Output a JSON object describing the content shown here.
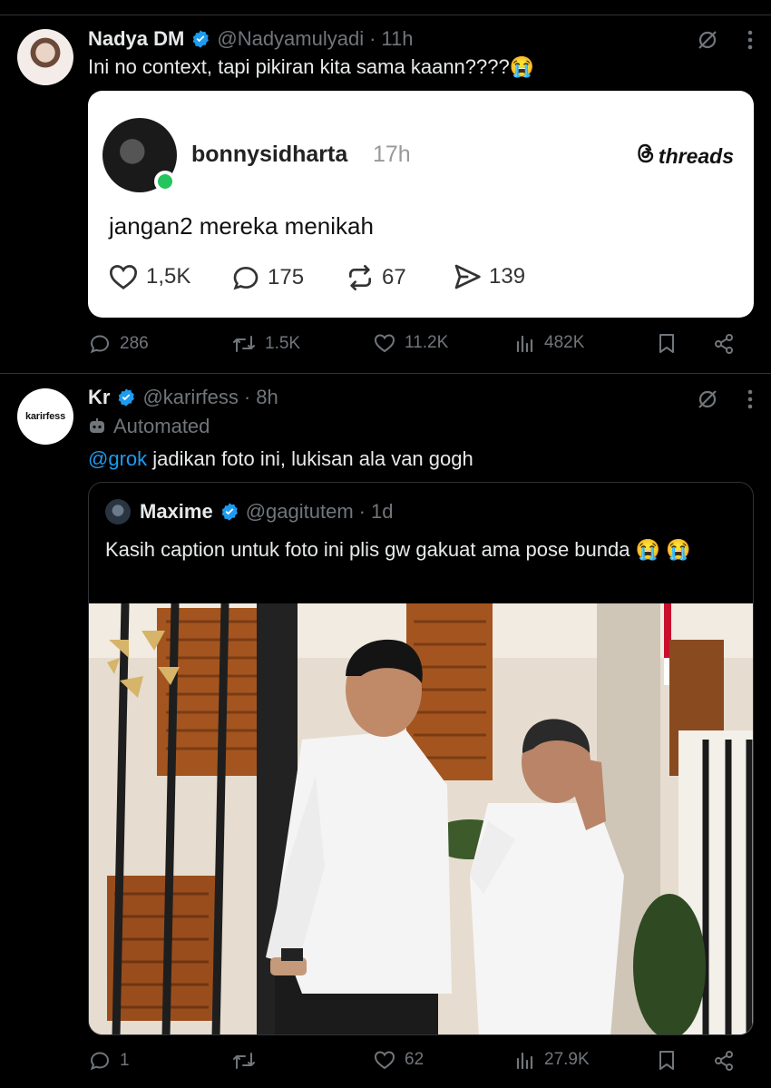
{
  "tweet1": {
    "name": "Nadya DM",
    "handle": "@Nadyamulyadi",
    "time": "11h",
    "text": "Ini no context, tapi pikiran kita sama kaann????😭",
    "embed": {
      "username": "bonnysidharta",
      "time": "17h",
      "brand": "threads",
      "text": "jangan2 mereka menikah",
      "likes": "1,5K",
      "replies": "175",
      "reposts": "67",
      "shares": "139"
    },
    "stats": {
      "replies": "286",
      "reposts": "1.5K",
      "likes": "11.2K",
      "views": "482K"
    }
  },
  "tweet2": {
    "avatar_text": "karirfess",
    "name": "Kr",
    "handle": "@karirfess",
    "time": "8h",
    "automated_label": "Automated",
    "mention": "@grok",
    "text": " jadikan foto ini, lukisan ala van gogh",
    "quote": {
      "name": "Maxime",
      "handle": "@gagitutem",
      "time": "1d",
      "text": "Kasih caption untuk foto ini plis gw gakuat ama pose bunda 😭 😭"
    },
    "stats": {
      "replies": "1",
      "reposts": "",
      "likes": "62",
      "views": "27.9K"
    }
  },
  "colors": {
    "background": "#000000",
    "muted": "#71767b",
    "accent": "#1d9bf0",
    "verified": "#1d9bf0",
    "online": "#22c55e"
  },
  "icons": [
    "verified-icon",
    "grok-icon",
    "more-icon",
    "reply-icon",
    "repost-icon",
    "like-icon",
    "views-icon",
    "bookmark-icon",
    "share-icon",
    "robot-icon",
    "threads-logo-icon"
  ]
}
